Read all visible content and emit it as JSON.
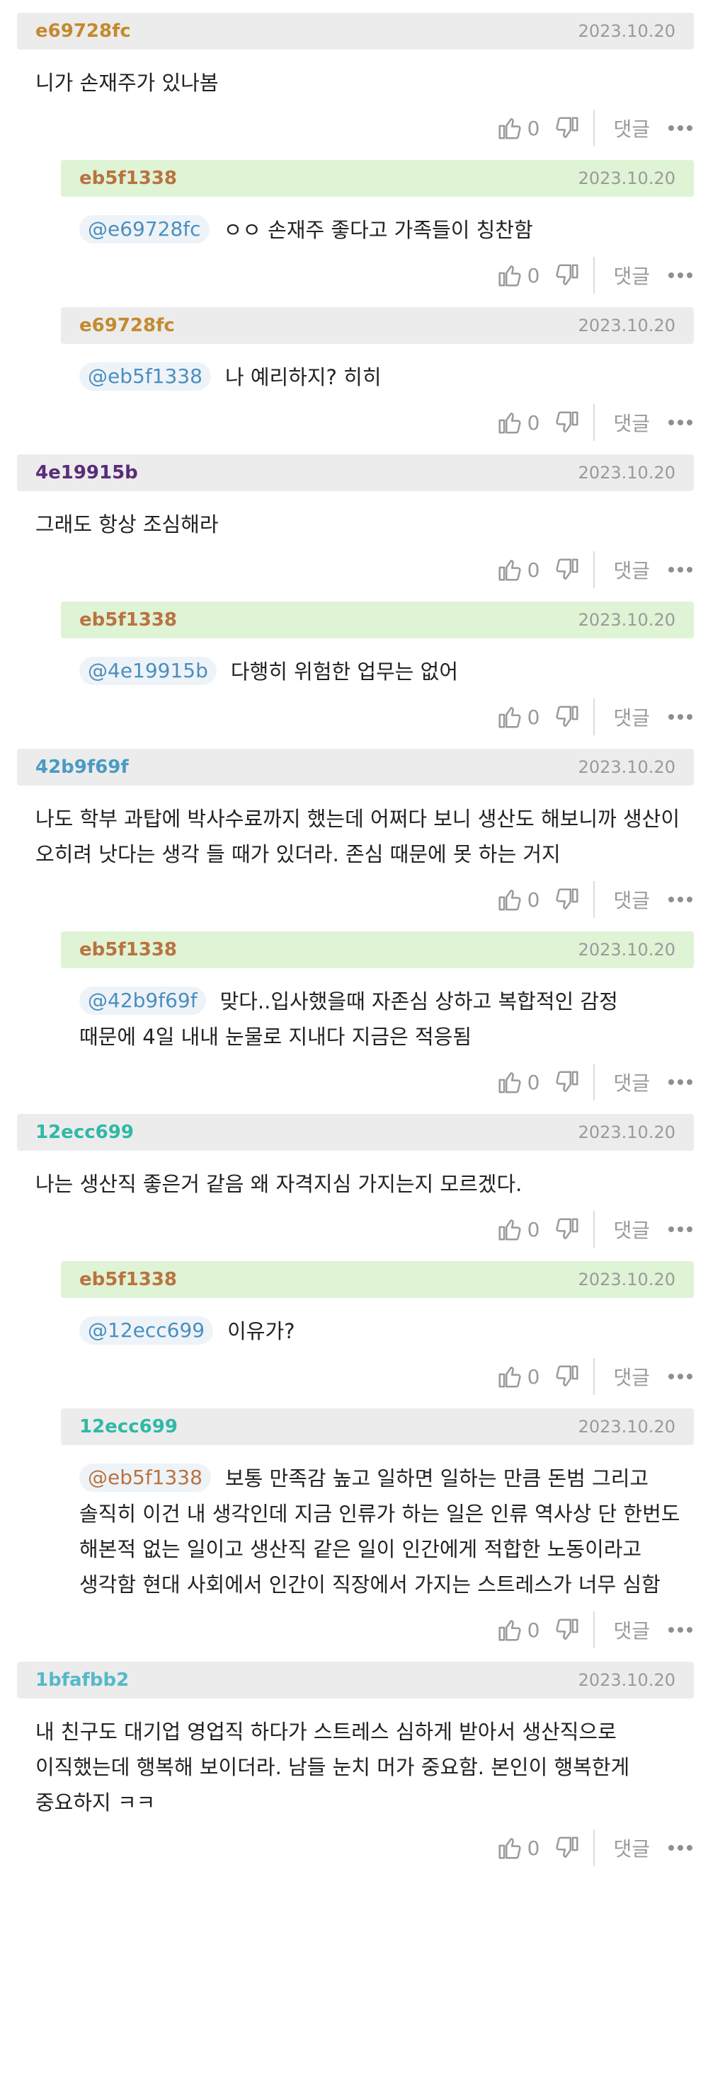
{
  "ui": {
    "reply_label": "댓글"
  },
  "colors": {
    "c_e69728fc": "#c48a2f",
    "c_eb5f1338": "#b9733f",
    "c_4e19915b": "#5a2c7a",
    "c_42b9f69f": "#4a9bc4",
    "c_12ecc699": "#2fb9a6",
    "c_1bfafbb2": "#55b9c9"
  },
  "comments": [
    {
      "author": "e69728fc",
      "date": "2023.10.20",
      "text": "니가 손재주가 있나봄",
      "likes": "0"
    },
    {
      "author": "eb5f1338",
      "date": "2023.10.20",
      "mention": "@e69728fc",
      "text": "ㅇㅇ 손재주 좋다고 가족들이 칭찬함",
      "likes": "0"
    },
    {
      "author": "e69728fc",
      "date": "2023.10.20",
      "mention": "@eb5f1338",
      "text": "나 예리하지? 히히",
      "likes": "0"
    },
    {
      "author": "4e19915b",
      "date": "2023.10.20",
      "text": "그래도 항상 조심해라",
      "likes": "0"
    },
    {
      "author": "eb5f1338",
      "date": "2023.10.20",
      "mention": "@4e19915b",
      "text": "다행히 위험한 업무는 없어",
      "likes": "0"
    },
    {
      "author": "42b9f69f",
      "date": "2023.10.20",
      "text": "나도 학부 과탑에 박사수료까지 했는데 어쩌다 보니 생산도 해보니까 생산이 오히려 낫다는 생각 들 때가 있더라. 존심 때문에 못 하는 거지",
      "likes": "0"
    },
    {
      "author": "eb5f1338",
      "date": "2023.10.20",
      "mention": "@42b9f69f",
      "text": "맞다..입사했을때 자존심 상하고 복합적인 감정 때문에 4일 내내 눈물로 지내다 지금은 적응됨",
      "likes": "0"
    },
    {
      "author": "12ecc699",
      "date": "2023.10.20",
      "text": "나는 생산직 좋은거 같음 왜 자격지심 가지는지 모르겠다.",
      "likes": "0"
    },
    {
      "author": "eb5f1338",
      "date": "2023.10.20",
      "mention": "@12ecc699",
      "text": "이유가?",
      "likes": "0"
    },
    {
      "author": "12ecc699",
      "date": "2023.10.20",
      "mention": "@eb5f1338",
      "text": "보통 만족감 높고 일하면 일하는 만큼 돈범 그리고 솔직히 이건 내 생각인데 지금 인류가 하는 일은 인류 역사상 단 한번도 해본적 없는 일이고 생산직 같은 일이 인간에게 적합한 노동이라고 생각함 현대 사회에서 인간이 직장에서 가지는 스트레스가 너무 심함",
      "likes": "0"
    },
    {
      "author": "1bfafbb2",
      "date": "2023.10.20",
      "text": "내 친구도 대기업 영업직 하다가 스트레스 심하게 받아서 생산직으로 이직했는데 행복해 보이더라. 남들 눈치 머가 중요함. 본인이 행복한게 중요하지 ㅋㅋ",
      "likes": "0"
    }
  ]
}
